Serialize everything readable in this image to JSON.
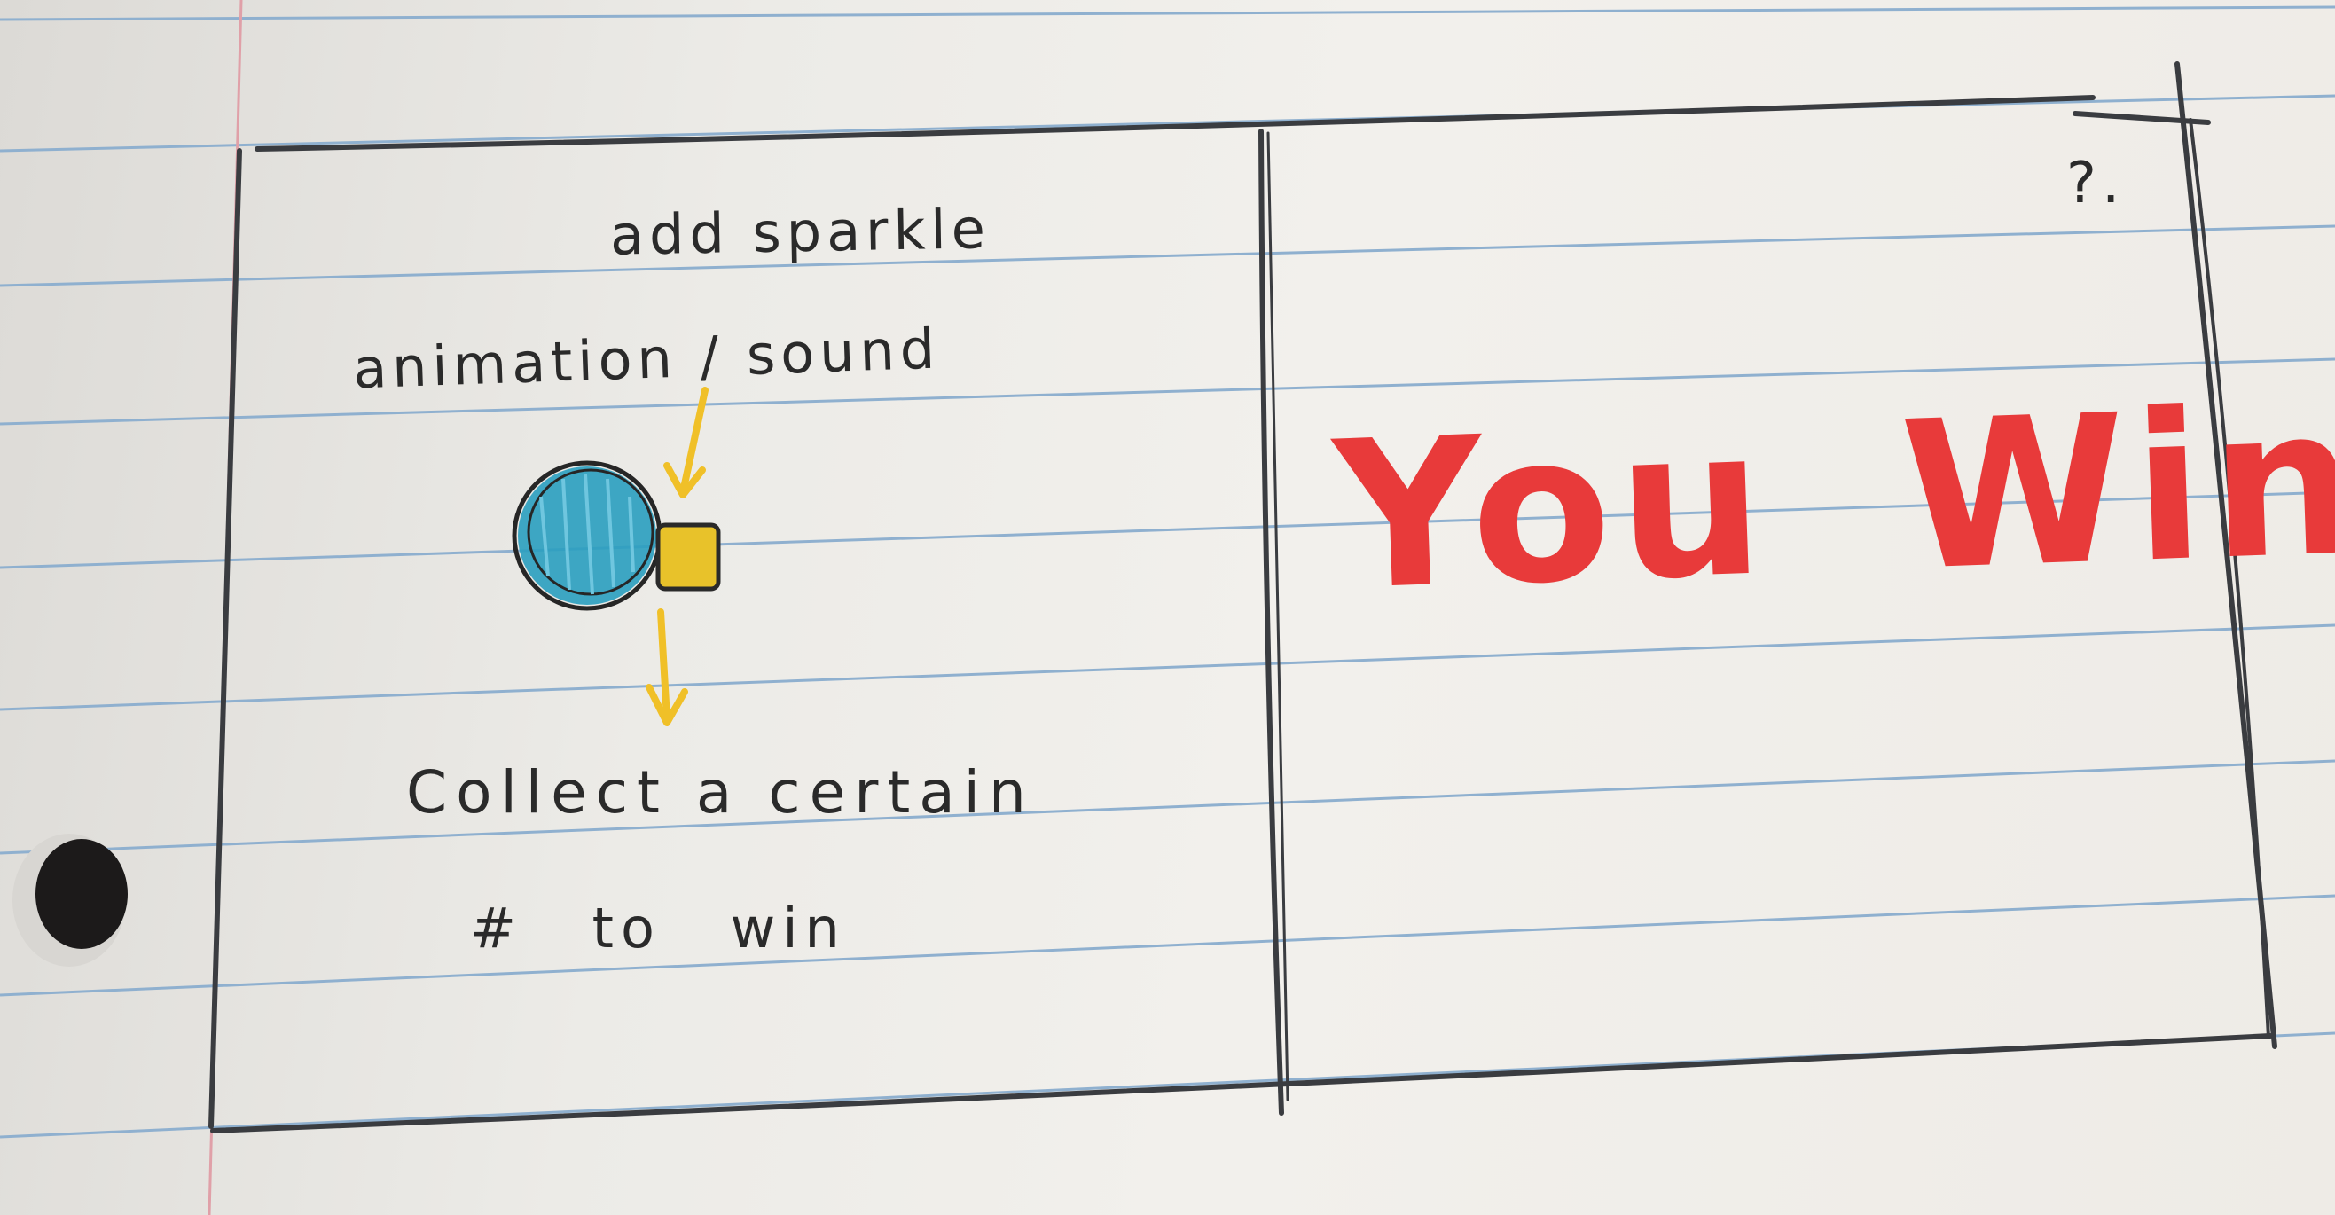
{
  "left_panel": {
    "note_sparkle": "add sparkle",
    "note_animation": "animation / sound",
    "note_collect": "Collect a certain",
    "note_win": "# to win"
  },
  "right_panel": {
    "headline": "You Win",
    "corner_mark": "?."
  },
  "colors": {
    "ink": "#2a2a2a",
    "headline_red": "#e83a3a",
    "coin_blue": "#2a9fbf",
    "item_yellow": "#e8c22a",
    "arrow_yellow": "#f0c028",
    "ruled_line_blue": "#8fb0cf",
    "margin_red": "#e0a0a8"
  },
  "icons": [
    "coin-icon",
    "item-square-icon",
    "arrow-down-icon",
    "punch-hole"
  ]
}
